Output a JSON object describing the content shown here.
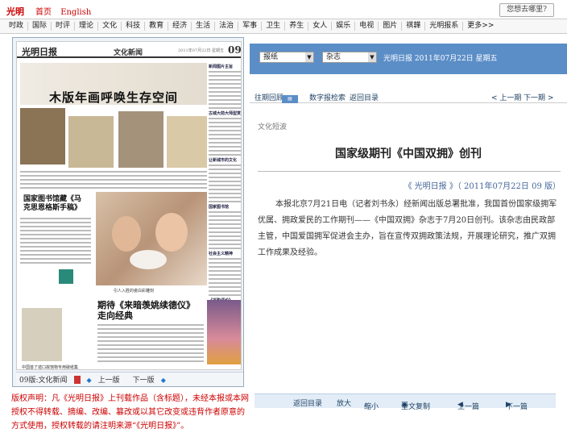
{
  "topbar": {
    "logo_text": "光明网",
    "home": "首页",
    "english": "English",
    "where_btn": "您想去哪里?"
  },
  "nav": [
    "时政",
    "国际",
    "时评",
    "理论",
    "文化",
    "科技",
    "教育",
    "经济",
    "生活",
    "法治",
    "军事",
    "卫生",
    "养生",
    "女人",
    "娱乐",
    "电视",
    "图片",
    "祺韡",
    "光明报系",
    "更多>>"
  ],
  "newspaper": {
    "masthead": "光明日报",
    "section": "文化新闻",
    "date": "2011年07月22日 星期五",
    "page_num": "09",
    "headline": "木版年画呼唤生存空间",
    "subhead1": "国家图书馆藏《马克思恩格斯手稿》",
    "subhead2": "期待《来暗羡姚续德仪》走向经典",
    "photo_caption": "引人入胜的瓷白彩雕刻",
    "doc_caption": "中国首了迹口故馆物专用破纸集",
    "right_col_titles": [
      "新闻图片主旨",
      "古城大前大师型赏",
      "让新城市的文化",
      "国家图书馆",
      "社会主义精神",
      "《采购评论》"
    ]
  },
  "page_nav": {
    "page_label": "09版:文化新闻",
    "prev": "上一版",
    "next": "下一版"
  },
  "copyright": "版权声明：凡《光明日报》上刊载作品（含标题），未经本报或本网授权不得转载、摘编、改编、篡改或以其它改变或违背作者原意的方式使用，授权转载的请注明来源“《光明日报》”。",
  "selectors": {
    "paper": "报纸",
    "magazine": "杂志",
    "date_label": "光明日报 2011年07月22日 星期五"
  },
  "util": {
    "history": "往期回顾",
    "digital_search": "数字报检索",
    "back_index": "返回目录",
    "prev_period": "< 上一期",
    "next_period": "下一期 >"
  },
  "article": {
    "category": "文化短波",
    "title": "国家级期刊《中国双拥》创刊",
    "source": "《 光明日报 》（ 2011年07月22日   09 版）",
    "body": "本报北京7月21日电（记者刘书永）经新闻出版总署批准，我国首份国家级拥军优属、拥政爱民的工作期刊——《中国双拥》杂志于7月20日创刊。该杂志由民政部主管，中国爱国拥军促进会主办，旨在宣传双拥政策法规，开展理论研究，推广双拥工作成果及经验。"
  },
  "bottom_bar": {
    "back": "返回目录",
    "zoom_in": "放大",
    "zoom_out": "缩小",
    "copy_all": "全文复制",
    "prev": "上一篇",
    "next": "下一篇"
  }
}
